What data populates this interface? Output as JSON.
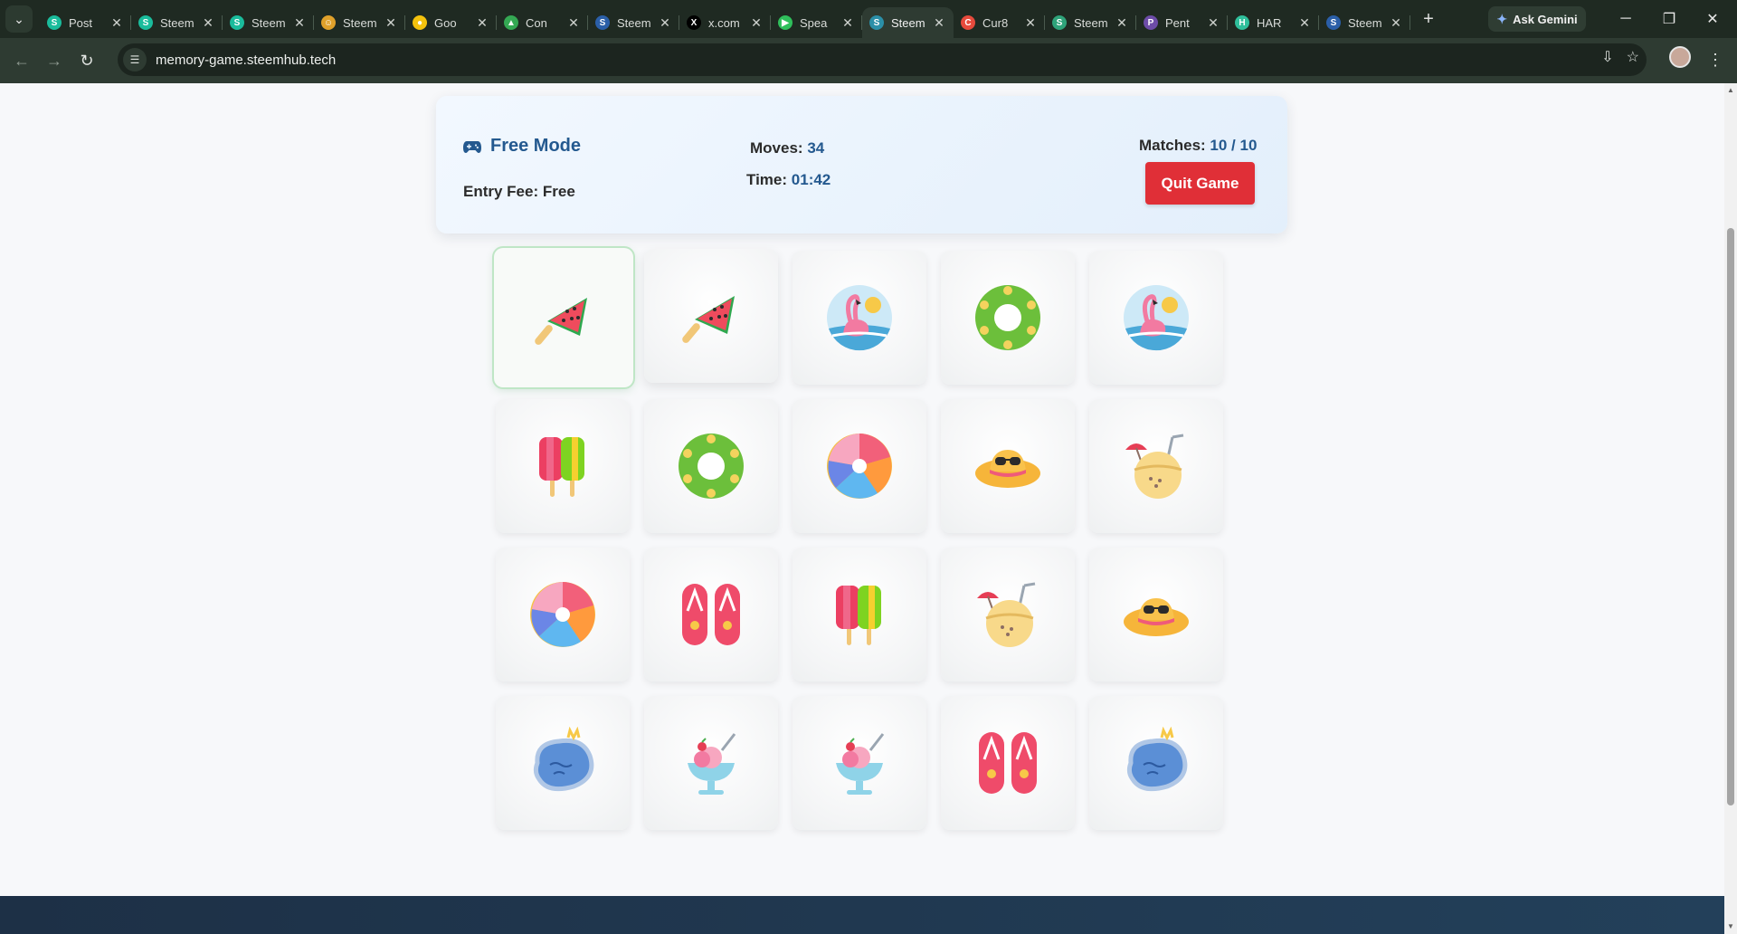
{
  "browser": {
    "tabs": [
      {
        "title": "Post",
        "icon": "steemhub-icon",
        "color": "#1abc9c"
      },
      {
        "title": "Steem",
        "icon": "steemhub-icon",
        "color": "#1abc9c"
      },
      {
        "title": "Steem",
        "icon": "steemhub-icon",
        "color": "#1abc9c"
      },
      {
        "title": "Steem",
        "icon": "emoji-icon",
        "color": "#e0a12b"
      },
      {
        "title": "Goo",
        "icon": "bulb-icon",
        "color": "#f4c20d"
      },
      {
        "title": "Con",
        "icon": "drive-icon",
        "color": "#34a853"
      },
      {
        "title": "Steem",
        "icon": "steem-icon",
        "color": "#2b5fa8"
      },
      {
        "title": "x.com",
        "icon": "x-icon",
        "color": "#000000"
      },
      {
        "title": "Spea",
        "icon": "play-icon",
        "color": "#2fbf5b"
      },
      {
        "title": "Steem",
        "icon": "steem-icon",
        "color": "#2b8fa8"
      },
      {
        "title": "Cur8",
        "icon": "cur8-icon",
        "color": "#e64a3c"
      },
      {
        "title": "Steem",
        "icon": "steem-icon",
        "color": "#2fa37a"
      },
      {
        "title": "Pent",
        "icon": "pent-icon",
        "color": "#6d4ca8"
      },
      {
        "title": "HAR",
        "icon": "har-icon",
        "color": "#2fbf9b"
      },
      {
        "title": "Steem",
        "icon": "steem-icon",
        "color": "#2b5fa8"
      }
    ],
    "active_tab": 9,
    "gemini_label": "Ask Gemini",
    "url": "memory-game.steemhub.tech"
  },
  "game": {
    "mode_label": "Free Mode",
    "entry_fee_label": "Entry Fee:",
    "entry_fee_value": "Free",
    "moves_label": "Moves:",
    "moves_value": "34",
    "time_label": "Time:",
    "time_value": "01:42",
    "matches_label": "Matches:",
    "matches_value": "10 / 10",
    "quit_label": "Quit Game",
    "colors": {
      "accent": "#24598f",
      "quit": "#e02f37"
    }
  },
  "cards": [
    {
      "icon": "watermelon-popsicle-icon"
    },
    {
      "icon": "watermelon-popsicle-icon"
    },
    {
      "icon": "flamingo-sun-icon"
    },
    {
      "icon": "swim-ring-icon"
    },
    {
      "icon": "flamingo-sun-icon"
    },
    {
      "icon": "ice-pops-icon"
    },
    {
      "icon": "swim-ring-icon"
    },
    {
      "icon": "beach-ball-icon"
    },
    {
      "icon": "sun-hat-icon"
    },
    {
      "icon": "coconut-drink-icon"
    },
    {
      "icon": "beach-ball-icon"
    },
    {
      "icon": "flip-flops-icon"
    },
    {
      "icon": "ice-pops-icon"
    },
    {
      "icon": "coconut-drink-icon"
    },
    {
      "icon": "sun-hat-icon"
    },
    {
      "icon": "pool-icon"
    },
    {
      "icon": "ice-cream-cup-icon"
    },
    {
      "icon": "ice-cream-cup-icon"
    },
    {
      "icon": "flip-flops-icon"
    },
    {
      "icon": "pool-icon"
    }
  ]
}
